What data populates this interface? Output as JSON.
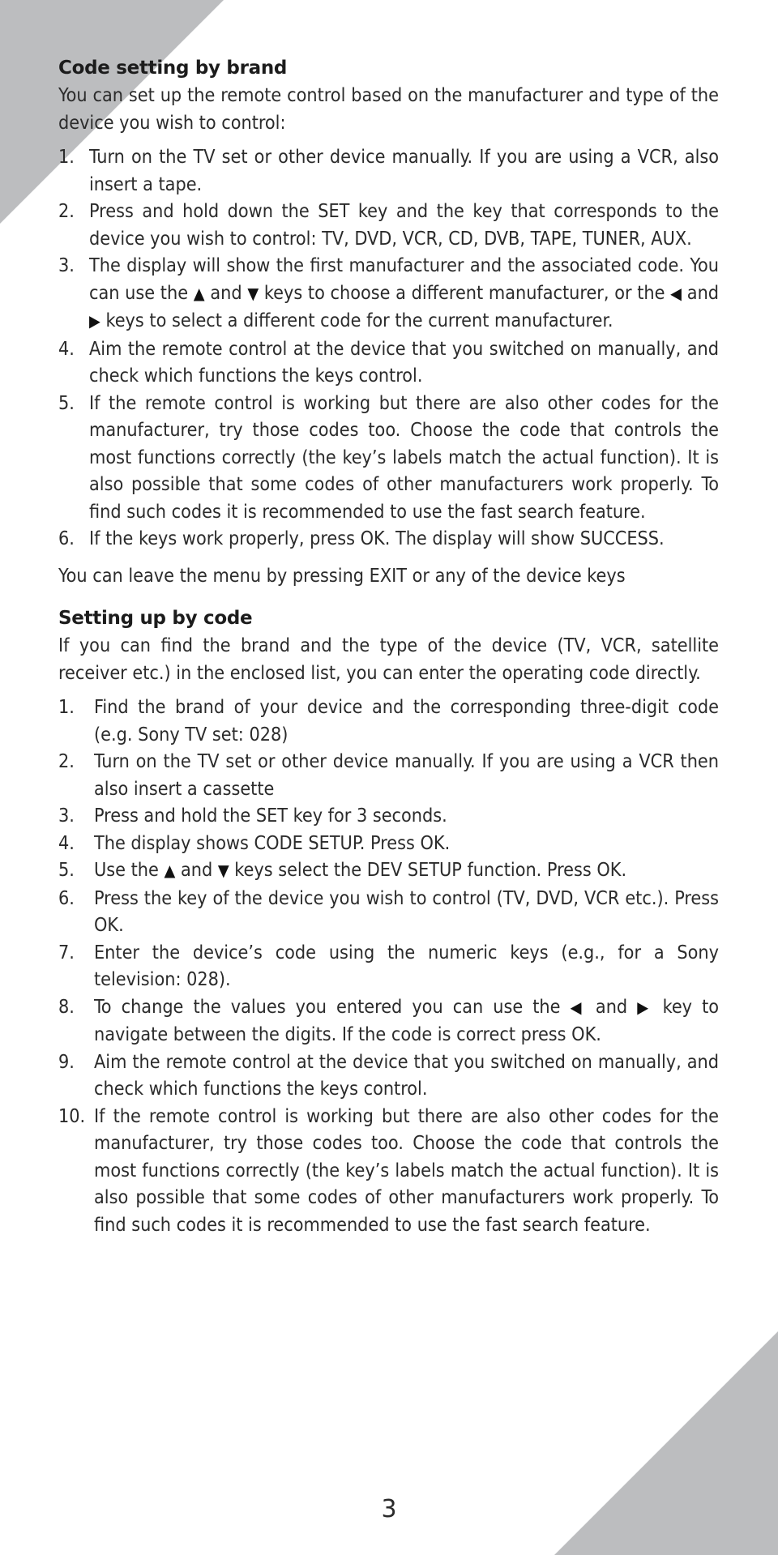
{
  "colors": {
    "corner_fill": "#bcbdbf",
    "text": "#2b2b2b",
    "heading": "#1c1c1c",
    "background": "#ffffff"
  },
  "section_brand": {
    "title": "Code setting by brand",
    "intro": "You can set up the remote control based on the manufacturer and type of the device you wish to control:",
    "steps": [
      {
        "num": "1.",
        "text": "Turn on the TV set or other device manually. If you are using a VCR, also insert a tape."
      },
      {
        "num": "2.",
        "text": "Press and hold down the SET key and the key that corresponds to the device you wish to control: TV, DVD, VCR, CD, DVB, TAPE, TUNER, AUX."
      },
      {
        "num": "3.",
        "text_a": "The display will show the first manufacturer and the associated code. You can use the",
        "up_icon": "▲",
        "text_b": "and",
        "down_icon": "▼",
        "text_c": "keys to choose a different manufacturer, or the",
        "left_icon": "◀",
        "text_d": "and",
        "right_icon": "▶",
        "text_e": "keys to select a different code for the current manufacturer."
      },
      {
        "num": "4.",
        "text": "Aim the remote control at the device that you switched on manually, and check which functions the keys control."
      },
      {
        "num": "5.",
        "text": "If the remote control is working but there are also other codes for the manufacturer, try those codes too. Choose the code that controls the most functions correctly (the key’s labels match the actual function). It is also possible that some codes of other manufacturers work properly. To find such codes it is recommended to use the fast search feature."
      },
      {
        "num": "6.",
        "text": "If the keys work properly, press OK. The display will show SUCCESS."
      }
    ],
    "exit_note": "You can leave the menu by pressing EXIT or any of the device keys"
  },
  "section_code": {
    "title": "Setting up by code",
    "intro": "If you can find the brand and the type of the device (TV, VCR, satellite receiver etc.) in the enclosed list, you can enter the operating code directly.",
    "steps": [
      {
        "num": "1.",
        "text": "Find the brand of your device and the corresponding three-digit code (e.g. Sony TV set: 028)"
      },
      {
        "num": "2.",
        "text": "Turn on the TV set or other device manually. If you are using a VCR then also insert a cassette"
      },
      {
        "num": "3.",
        "text": "Press and hold the SET key for 3 seconds."
      },
      {
        "num": "4.",
        "text": "The display shows CODE SETUP. Press OK."
      },
      {
        "num": "5.",
        "text_a": "Use the",
        "up_icon": "▲",
        "text_b": "and",
        "down_icon": "▼",
        "text_c": "keys select the DEV SETUP function. Press OK."
      },
      {
        "num": "6.",
        "text": "Press the key of the device you wish to control (TV, DVD, VCR etc.). Press OK."
      },
      {
        "num": "7.",
        "text": "Enter the device’s code using the numeric keys (e.g., for a Sony television: 028)."
      },
      {
        "num": "8.",
        "text_a": "To change the values you entered you can use the",
        "left_icon": "◀",
        "text_b": "and",
        "right_icon": "▶",
        "text_c": "key to navigate between the digits. If the code is correct press OK."
      },
      {
        "num": "9.",
        "text": "Aim the remote control at the device that you switched on manually, and check which functions the keys control."
      },
      {
        "num": "10.",
        "text": "If the remote control is working but there are also other codes for the manufacturer, try those codes too. Choose the code that controls the most functions correctly (the key’s labels match the actual function). It is also possible that some codes of other manufacturers work properly. To find such codes it is recommended to use the fast search feature."
      }
    ]
  },
  "footer": {
    "page_number": "3"
  }
}
